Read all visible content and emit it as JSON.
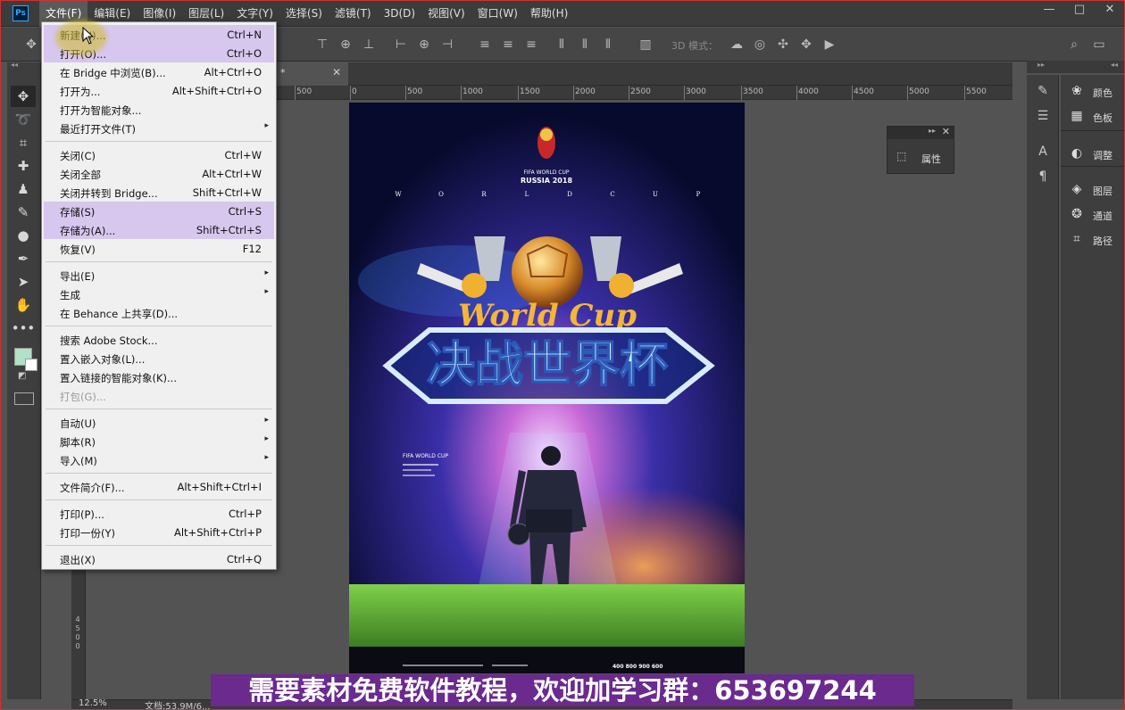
{
  "app": {
    "logo": "Ps"
  },
  "menubar": {
    "items": [
      "文件(F)",
      "编辑(E)",
      "图像(I)",
      "图层(L)",
      "文字(Y)",
      "选择(S)",
      "滤镜(T)",
      "3D(D)",
      "视图(V)",
      "窗口(W)",
      "帮助(H)"
    ],
    "active_index": 0,
    "window_controls": [
      "—",
      "□",
      "✕"
    ]
  },
  "options_bar": {
    "mode3d_label": "3D 模式："
  },
  "rulers": {
    "top_labels": [
      "500",
      "0",
      "500",
      "1000",
      "1500",
      "2000",
      "2500",
      "3000",
      "3500",
      "4000",
      "4500",
      "5000",
      "5500"
    ],
    "left_labels": [
      "0",
      "0",
      "5",
      "0",
      "0",
      "0",
      "4",
      "5",
      "0",
      "0"
    ]
  },
  "status": {
    "zoom": "12.5%",
    "doc_size": "文档:53.9M/6..."
  },
  "file_menu": {
    "groups": [
      [
        {
          "label": "新建(N)...",
          "shortcut": "Ctrl+N",
          "highlight": true
        },
        {
          "label": "打开(O)...",
          "shortcut": "Ctrl+O",
          "highlight": true
        },
        {
          "label": "在 Bridge 中浏览(B)...",
          "shortcut": "Alt+Ctrl+O"
        },
        {
          "label": "打开为...",
          "shortcut": "Alt+Shift+Ctrl+O"
        },
        {
          "label": "打开为智能对象...",
          "shortcut": ""
        },
        {
          "label": "最近打开文件(T)",
          "shortcut": "",
          "submenu": true
        }
      ],
      [
        {
          "label": "关闭(C)",
          "shortcut": "Ctrl+W"
        },
        {
          "label": "关闭全部",
          "shortcut": "Alt+Ctrl+W"
        },
        {
          "label": "关闭并转到 Bridge...",
          "shortcut": "Shift+Ctrl+W"
        },
        {
          "label": "存储(S)",
          "shortcut": "Ctrl+S",
          "highlight": true
        },
        {
          "label": "存储为(A)...",
          "shortcut": "Shift+Ctrl+S",
          "highlight": true
        },
        {
          "label": "恢复(V)",
          "shortcut": "F12"
        }
      ],
      [
        {
          "label": "导出(E)",
          "shortcut": "",
          "submenu": true
        },
        {
          "label": "生成",
          "shortcut": "",
          "submenu": true
        },
        {
          "label": "在 Behance 上共享(D)...",
          "shortcut": ""
        }
      ],
      [
        {
          "label": "搜索 Adobe Stock...",
          "shortcut": ""
        },
        {
          "label": "置入嵌入对象(L)...",
          "shortcut": ""
        },
        {
          "label": "置入链接的智能对象(K)...",
          "shortcut": ""
        },
        {
          "label": "打包(G)...",
          "shortcut": "",
          "disabled": true
        }
      ],
      [
        {
          "label": "自动(U)",
          "shortcut": "",
          "submenu": true
        },
        {
          "label": "脚本(R)",
          "shortcut": "",
          "submenu": true
        },
        {
          "label": "导入(M)",
          "shortcut": "",
          "submenu": true
        }
      ],
      [
        {
          "label": "文件简介(F)...",
          "shortcut": "Alt+Shift+Ctrl+I"
        }
      ],
      [
        {
          "label": "打印(P)...",
          "shortcut": "Ctrl+P"
        },
        {
          "label": "打印一份(Y)",
          "shortcut": "Alt+Shift+Ctrl+P"
        }
      ],
      [
        {
          "label": "退出(X)",
          "shortcut": "Ctrl+Q"
        }
      ]
    ]
  },
  "properties_panel": {
    "label": "属性"
  },
  "right_panels": [
    {
      "icon": "palette-icon",
      "label": "颜色"
    },
    {
      "icon": "grid-icon",
      "label": "色板"
    },
    {
      "icon": "adjust-icon",
      "label": "调整"
    },
    {
      "icon": "layers-icon",
      "label": "图层"
    },
    {
      "icon": "channels-icon",
      "label": "通道"
    },
    {
      "icon": "paths-icon",
      "label": "路径"
    }
  ],
  "poster": {
    "logo_text": "RUSSIA 2018",
    "logo_small": "FIFA WORLD CUP",
    "world_cup_letters": [
      "W",
      "O",
      "R",
      "L",
      "D",
      "C",
      "U",
      "P"
    ],
    "script_title": "World Cup",
    "main_title": "决战世界杯",
    "sub_label": "FIFA WORLD CUP",
    "phone": "400 800 900 600"
  },
  "banner": {
    "text": "需要素材免费软件教程，欢迎加学习群：653697244"
  },
  "colors": {
    "menu_highlight": "#d7c6ee",
    "banner": "#6a2a8e",
    "foreground_swatch": "#b2e0c8"
  }
}
